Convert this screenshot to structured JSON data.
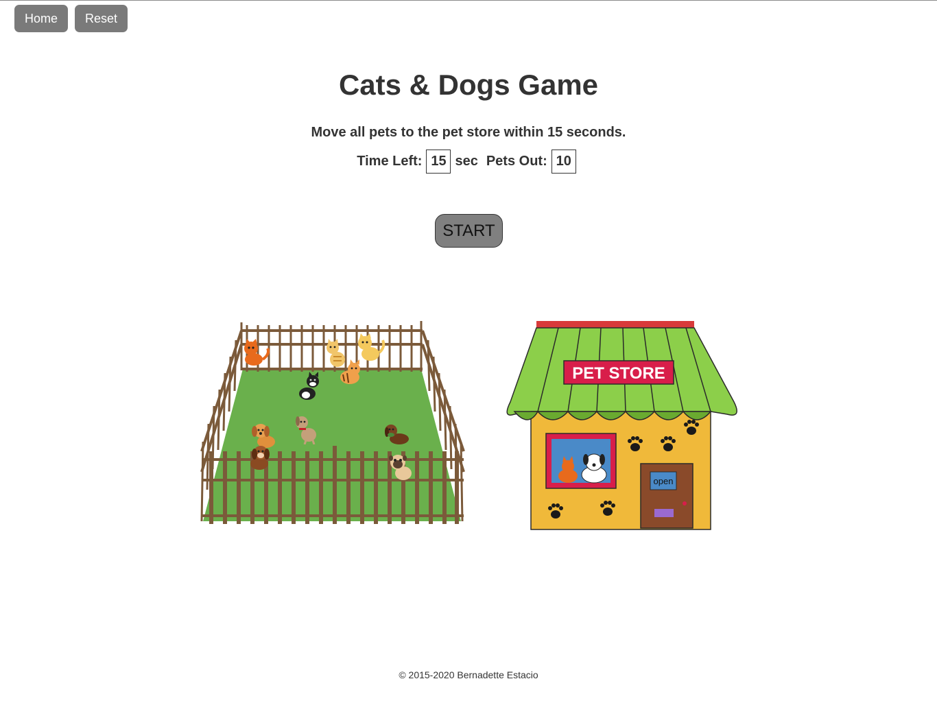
{
  "nav": {
    "home_label": "Home",
    "reset_label": "Reset"
  },
  "title": "Cats & Dogs Game",
  "instructions": "Move all pets to the pet store within 15 seconds.",
  "stats": {
    "time_label": "Time Left:",
    "time_value": "15",
    "time_unit": "sec",
    "pets_label": "Pets Out:",
    "pets_value": "10"
  },
  "start_label": "START",
  "store": {
    "sign_text": "PET STORE",
    "door_sign": "open"
  },
  "pets": [
    {
      "kind": "cat",
      "name": "orange-cat"
    },
    {
      "kind": "cat",
      "name": "tabby-cat"
    },
    {
      "kind": "cat",
      "name": "yellow-cat"
    },
    {
      "kind": "cat",
      "name": "striped-kitten"
    },
    {
      "kind": "cat",
      "name": "black-white-cat"
    },
    {
      "kind": "dog",
      "name": "tan-puppy"
    },
    {
      "kind": "dog",
      "name": "brown-puppy"
    },
    {
      "kind": "dog",
      "name": "gray-dog"
    },
    {
      "kind": "dog",
      "name": "dark-brown-dog"
    },
    {
      "kind": "dog",
      "name": "pug"
    }
  ],
  "colors": {
    "button_gray": "#7a7a7a",
    "grass": "#6ab04c",
    "fence": "#7b5a3a",
    "roof_green": "#8ccf4a",
    "store_wall": "#f0b93a",
    "sign_red": "#d81e4a"
  },
  "footer": "© 2015-2020 Bernadette Estacio"
}
